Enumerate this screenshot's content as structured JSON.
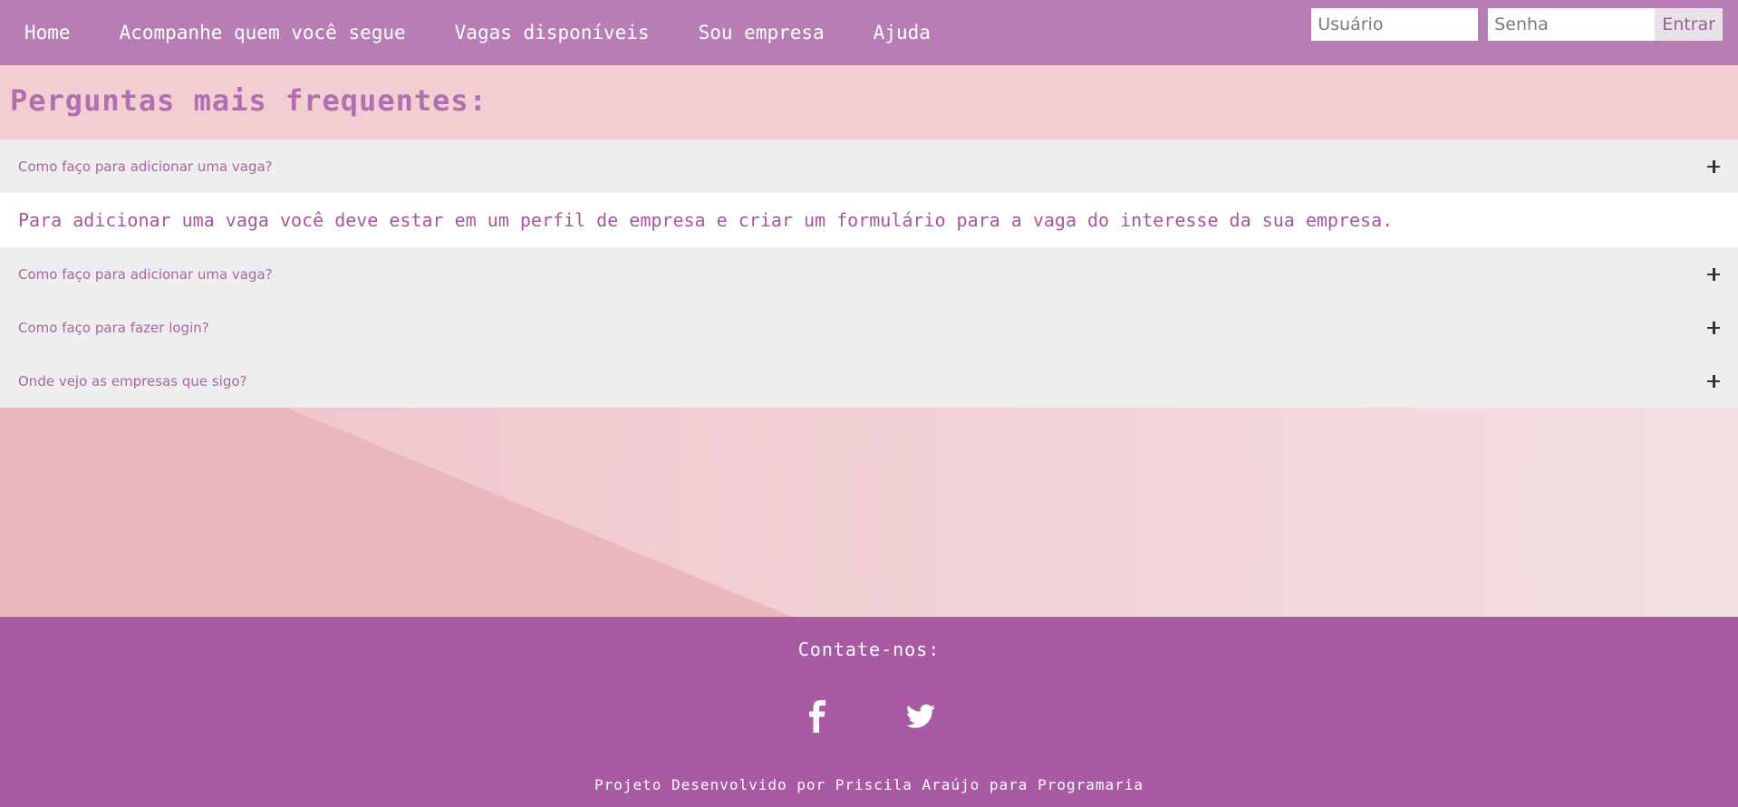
{
  "nav": {
    "links": [
      "Home",
      "Acompanhe quem você segue",
      "Vagas disponíveis",
      "Sou empresa",
      "Ajuda"
    ]
  },
  "login": {
    "username_placeholder": "Usuário",
    "password_placeholder": "Senha",
    "submit_label": "Entrar"
  },
  "faq": {
    "title": "Perguntas mais frequentes:",
    "items": [
      {
        "question": "Como faço para adicionar uma vaga?",
        "answer": "Para adicionar uma vaga você deve estar em um perfil de empresa e criar um formulário para a vaga do interesse da sua empresa."
      },
      {
        "question": "Como faço para adicionar uma vaga?"
      },
      {
        "question": "Como faço para fazer login?"
      },
      {
        "question": "Onde vejo as empresas que sigo?"
      }
    ]
  },
  "footer": {
    "contact_title": "Contate-nos:",
    "social_icons": [
      "facebook-icon",
      "twitter-icon"
    ],
    "credits": "Projeto Desenvolvido por Priscila Araújo para Programaria"
  },
  "colors": {
    "nav_bg": "#b87db5",
    "header_bg": "#f2cdd1",
    "question_bg": "#eeeeee",
    "accent_text": "#a8669f",
    "footer_bg": "#a85aa3"
  }
}
